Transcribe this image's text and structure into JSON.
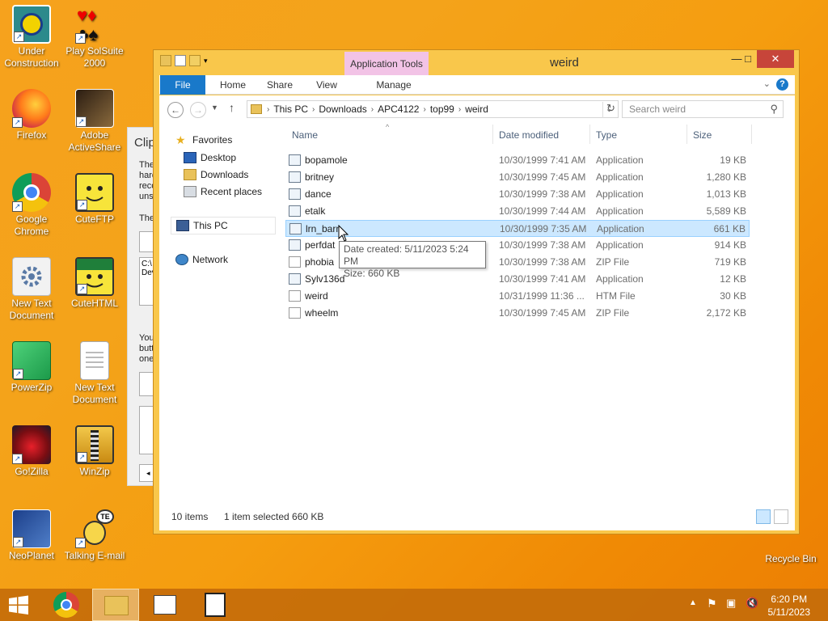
{
  "desktop": {
    "icons": [
      {
        "label": "Under Construction",
        "icon": "under-construction-icon"
      },
      {
        "label": "Play SolSuite 2000",
        "icon": "cards-icon"
      },
      {
        "label": "Firefox",
        "icon": "firefox-icon"
      },
      {
        "label": "Adobe ActiveShare",
        "icon": "adobe-activeshare-icon"
      },
      {
        "label": "Google Chrome",
        "icon": "chrome-icon"
      },
      {
        "label": "CuteFTP",
        "icon": "cuteftp-icon"
      },
      {
        "label": "New Text Document",
        "icon": "settings-icon"
      },
      {
        "label": "CuteHTML",
        "icon": "cutehtml-icon"
      },
      {
        "label": "PowerZip",
        "icon": "powerzip-icon"
      },
      {
        "label": "New Text Document",
        "icon": "text-document-icon"
      },
      {
        "label": "Go!Zilla",
        "icon": "gozilla-icon"
      },
      {
        "label": "WinZip",
        "icon": "winzip-icon"
      },
      {
        "label": "NeoPlanet",
        "icon": "neoplanet-icon"
      },
      {
        "label": "Talking E-mail",
        "icon": "talking-email-icon"
      },
      {
        "label": "Recycle Bin",
        "icon": "recycle-bin-icon"
      }
    ]
  },
  "background_dialog": {
    "title": "Clip",
    "lines": [
      "The",
      "hard",
      "reco",
      "uns",
      "The",
      "C:\\",
      "Dev",
      "You",
      "butt",
      "one"
    ]
  },
  "window": {
    "title": "weird",
    "context_tab": "Application Tools",
    "controls": {
      "minimize": "—",
      "maximize": "□",
      "close": "✕"
    },
    "ribbon_tabs": [
      "File",
      "Home",
      "Share",
      "View",
      "Manage"
    ],
    "address": {
      "crumbs": [
        "This PC",
        "Downloads",
        "APC4122",
        "top99",
        "weird"
      ]
    },
    "search": {
      "placeholder": "Search weird"
    },
    "nav_pane": {
      "favorites": "Favorites",
      "favorite_items": [
        "Desktop",
        "Downloads",
        "Recent places"
      ],
      "this_pc": "This PC",
      "network": "Network"
    },
    "columns": [
      "Name",
      "Date modified",
      "Type",
      "Size"
    ],
    "files": [
      {
        "name": "bopamole",
        "date": "10/30/1999 7:41 AM",
        "type": "Application",
        "size": "19 KB"
      },
      {
        "name": "britney",
        "date": "10/30/1999 7:45 AM",
        "type": "Application",
        "size": "1,280 KB"
      },
      {
        "name": "dance",
        "date": "10/30/1999 7:38 AM",
        "type": "Application",
        "size": "1,013 KB"
      },
      {
        "name": "etalk",
        "date": "10/30/1999 7:44 AM",
        "type": "Application",
        "size": "5,589 KB"
      },
      {
        "name": "lrn_barn",
        "date": "10/30/1999 7:35 AM",
        "type": "Application",
        "size": "661 KB"
      },
      {
        "name": "perfdat",
        "date": "10/30/1999 7:38 AM",
        "type": "Application",
        "size": "914 KB"
      },
      {
        "name": "phobia",
        "date": "10/30/1999 7:38 AM",
        "type": "ZIP File",
        "size": "719 KB"
      },
      {
        "name": "Sylv136d",
        "date": "10/30/1999 7:41 AM",
        "type": "Application",
        "size": "12 KB"
      },
      {
        "name": "weird",
        "date": "10/31/1999 11:36 ...",
        "type": "HTM File",
        "size": "30 KB"
      },
      {
        "name": "wheelm",
        "date": "10/30/1999 7:45 AM",
        "type": "ZIP File",
        "size": "2,172 KB"
      }
    ],
    "selected_index": 4,
    "tooltip": {
      "line1": "Date created: 5/11/2023 5:24 PM",
      "line2": "Size: 660 KB"
    },
    "status": {
      "items": "10 items",
      "selection": "1 item selected  660 KB"
    }
  },
  "taskbar": {
    "time": "6:20 PM",
    "date": "5/11/2023"
  }
}
